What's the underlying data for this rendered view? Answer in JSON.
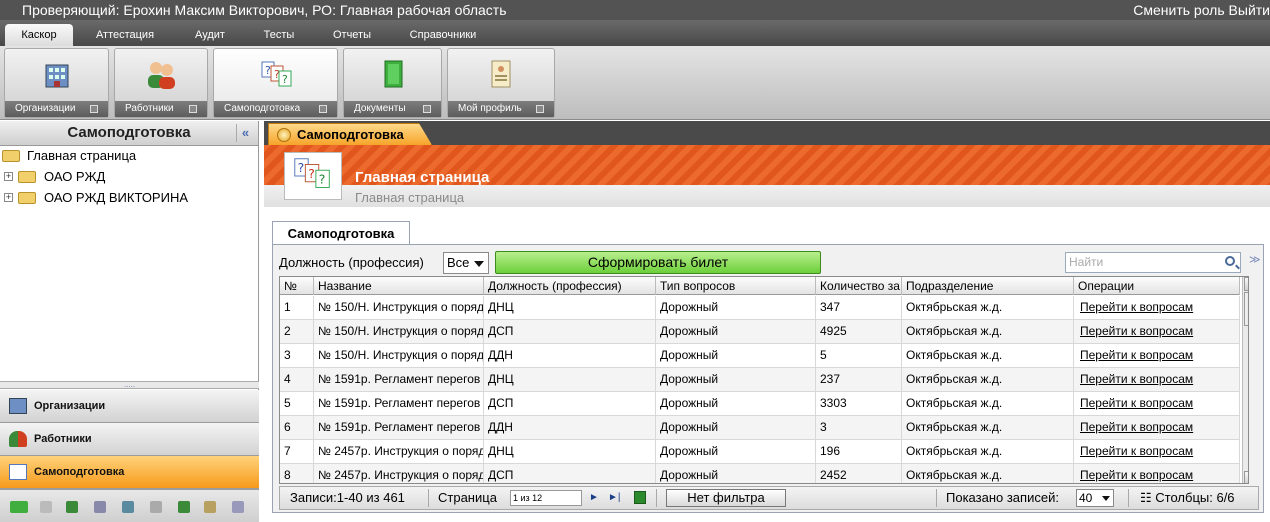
{
  "topbar": {
    "reviewer": "Проверяющий: Ерохин Максим Викторович, РО: Главная рабочая область",
    "switch_role": "Сменить роль",
    "logout": "Выйти"
  },
  "menu": {
    "tabs": [
      "Каскор",
      "Аттестация",
      "Аудит",
      "Тесты",
      "Отчеты",
      "Справочники"
    ],
    "active": "Каскор"
  },
  "ribbon": {
    "buttons": [
      "Организации",
      "Работники",
      "Самоподготовка",
      "Документы",
      "Мой профиль"
    ]
  },
  "left": {
    "title": "Самоподготовка",
    "tree": {
      "root": "Главная страница",
      "children": [
        "ОАО РЖД",
        "ОАО РЖД ВИКТОРИНА"
      ]
    },
    "accordion": [
      "Организации",
      "Работники",
      "Самоподготовка"
    ]
  },
  "main": {
    "tab": "Самоподготовка",
    "banner_title": "Главная страница",
    "banner_subtitle": "Главная страница",
    "panel_tab": "Самоподготовка",
    "filter_label": "Должность (профессия)",
    "filter_value": "Все",
    "generate_button": "Сформировать билет",
    "search_placeholder": "Найти"
  },
  "grid": {
    "columns": [
      "№",
      "Название",
      "Должность (профессия)",
      "Тип вопросов",
      "Количество за",
      "Подразделение",
      "Операции"
    ],
    "rows": [
      [
        "1",
        "№ 150/Н. Инструкция о поряд",
        "ДНЦ",
        "Дорожный",
        "347",
        "Октябрьская ж.д.",
        "Перейти к вопросам"
      ],
      [
        "2",
        "№ 150/Н. Инструкция о поряд",
        "ДСП",
        "Дорожный",
        "4925",
        "Октябрьская ж.д.",
        "Перейти к вопросам"
      ],
      [
        "3",
        "№ 150/Н. Инструкция о поряд",
        "ДДН",
        "Дорожный",
        "5",
        "Октябрьская ж.д.",
        "Перейти к вопросам"
      ],
      [
        "4",
        "№ 1591р. Регламент перегов",
        "ДНЦ",
        "Дорожный",
        "237",
        "Октябрьская ж.д.",
        "Перейти к вопросам"
      ],
      [
        "5",
        "№ 1591р. Регламент перегов",
        "ДСП",
        "Дорожный",
        "3303",
        "Октябрьская ж.д.",
        "Перейти к вопросам"
      ],
      [
        "6",
        "№ 1591р. Регламент перегов",
        "ДДН",
        "Дорожный",
        "3",
        "Октябрьская ж.д.",
        "Перейти к вопросам"
      ],
      [
        "7",
        "№ 2457р. Инструкция о поряд",
        "ДНЦ",
        "Дорожный",
        "196",
        "Октябрьская ж.д.",
        "Перейти к вопросам"
      ],
      [
        "8",
        "№ 2457р. Инструкция о поряд",
        "ДСП",
        "Дорожный",
        "2452",
        "Октябрьская ж.д.",
        "Перейти к вопросам"
      ]
    ]
  },
  "pager": {
    "records": "Записи:1-40 из 461",
    "page_label": "Страница",
    "page_value": "1 из 12",
    "no_filter": "Нет фильтра",
    "shown_label": "Показано записей:",
    "shown_value": "40",
    "columns": "Столбцы: 6/6"
  },
  "colors": {
    "accent_orange": "#f79a1a",
    "banner_orange": "#e0561c",
    "generate_green": "#6ccf3a"
  }
}
